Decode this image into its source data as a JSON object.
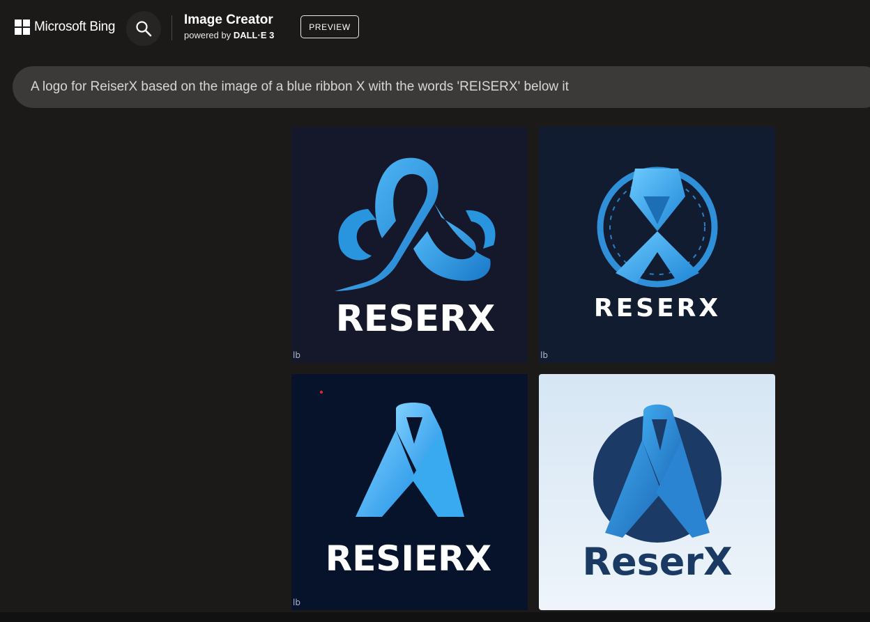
{
  "header": {
    "brand_label": "Microsoft Bing",
    "app_title": "Image Creator",
    "subtitle_prefix": "powered by",
    "subtitle_model": "DALL·E 3",
    "preview_badge": "PREVIEW"
  },
  "prompt": {
    "text": "A logo for ReiserX based on the image of a blue ribbon X with the words 'REISERX' below it"
  },
  "results": {
    "images": [
      {
        "logo_text": "RESERX",
        "watermark": "lb"
      },
      {
        "logo_text": "RESERX",
        "watermark": "lb"
      },
      {
        "logo_text": "RESIERX",
        "watermark": "lb"
      },
      {
        "logo_text": "ReserX"
      }
    ]
  },
  "colors": {
    "page_bg": "#1b1a19",
    "prompt_bg": "#3b3a39",
    "ribbon_blue": "#2fa3e8",
    "tile4_text": "#1a3a63"
  }
}
